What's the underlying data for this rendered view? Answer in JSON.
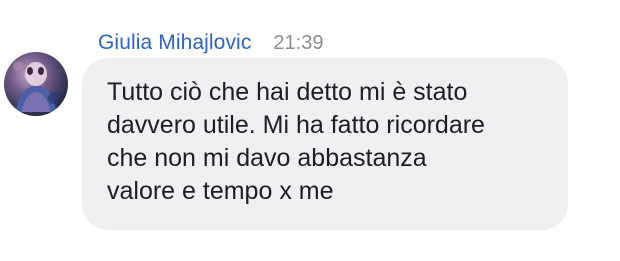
{
  "message": {
    "sender": "Giulia Mihajlovic",
    "time": "21:39",
    "text": "Tutto ciò che hai detto mi è stato\ndavvero utile. Mi ha fatto ricordare\nche non mi davo abbastanza\nvalore e tempo x me"
  },
  "icons": {
    "avatar": "profile-photo"
  },
  "colors": {
    "sender_name": "#2d62c8",
    "timestamp": "#8a8d91",
    "bubble_background": "#f0f0f3",
    "message_text": "#1c1e21"
  }
}
